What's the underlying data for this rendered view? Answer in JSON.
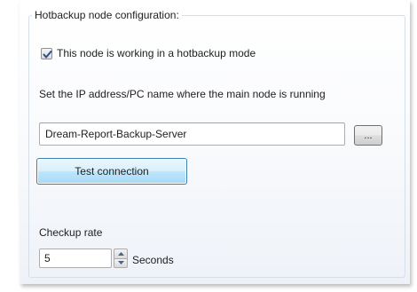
{
  "group": {
    "title": "Hotbackup node configuration:"
  },
  "hotbackup_mode": {
    "label": "This node is working in a hotbackup mode",
    "checked": true
  },
  "main_node": {
    "instruction": "Set the IP address/PC name where the main node is running",
    "address_value": "Dream-Report-Backup-Server",
    "browse_label": "..."
  },
  "test_connection": {
    "label": "Test connection"
  },
  "checkup_rate": {
    "label": "Checkup rate",
    "value": "5",
    "unit": "Seconds"
  },
  "colors": {
    "check_mark": "#2f4d8a",
    "default_button_border": "#3c7fb1",
    "frame_border": "#d5dfe5"
  },
  "icons": {
    "check": "check-icon",
    "spin_up": "triangle-up-icon",
    "spin_down": "triangle-down-icon"
  }
}
